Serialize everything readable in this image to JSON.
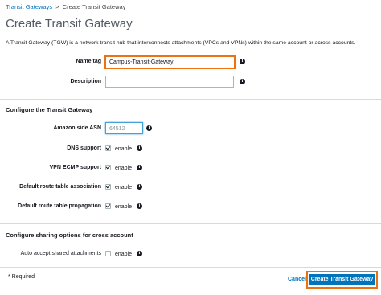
{
  "breadcrumb": {
    "link": "Transit Gateways",
    "separator": ">",
    "current": "Create Transit Gateway"
  },
  "page": {
    "title": "Create Transit Gateway",
    "intro": "A Transit Gateway (TGW) is a network transit hub that interconnects attachments (VPCs and VPNs) within the same account or across accounts."
  },
  "fields": {
    "name_tag": {
      "label": "Name tag",
      "value": "Campus-Transit-Gateway"
    },
    "description": {
      "label": "Description",
      "value": ""
    }
  },
  "configure": {
    "title": "Configure the Transit Gateway",
    "asn": {
      "label": "Amazon side ASN",
      "value": "64512"
    },
    "options": [
      {
        "label": "DNS support",
        "text": "enable",
        "checked": true
      },
      {
        "label": "VPN ECMP support",
        "text": "enable",
        "checked": true
      },
      {
        "label": "Default route table association",
        "text": "enable",
        "checked": true
      },
      {
        "label": "Default route table propagation",
        "text": "enable",
        "checked": true
      }
    ]
  },
  "sharing": {
    "title": "Configure sharing options for cross account",
    "auto_accept": {
      "label": "Auto accept shared attachments",
      "text": "enable",
      "checked": false
    }
  },
  "footer": {
    "required": "* Required",
    "cancel": "Cancel",
    "create": "Create Transit Gateway"
  },
  "icons": {
    "info": "info-icon",
    "info_glyph": "i"
  },
  "colors": {
    "link": "#0073bb",
    "primary": "#0073bb",
    "highlight": "#ec7211"
  }
}
